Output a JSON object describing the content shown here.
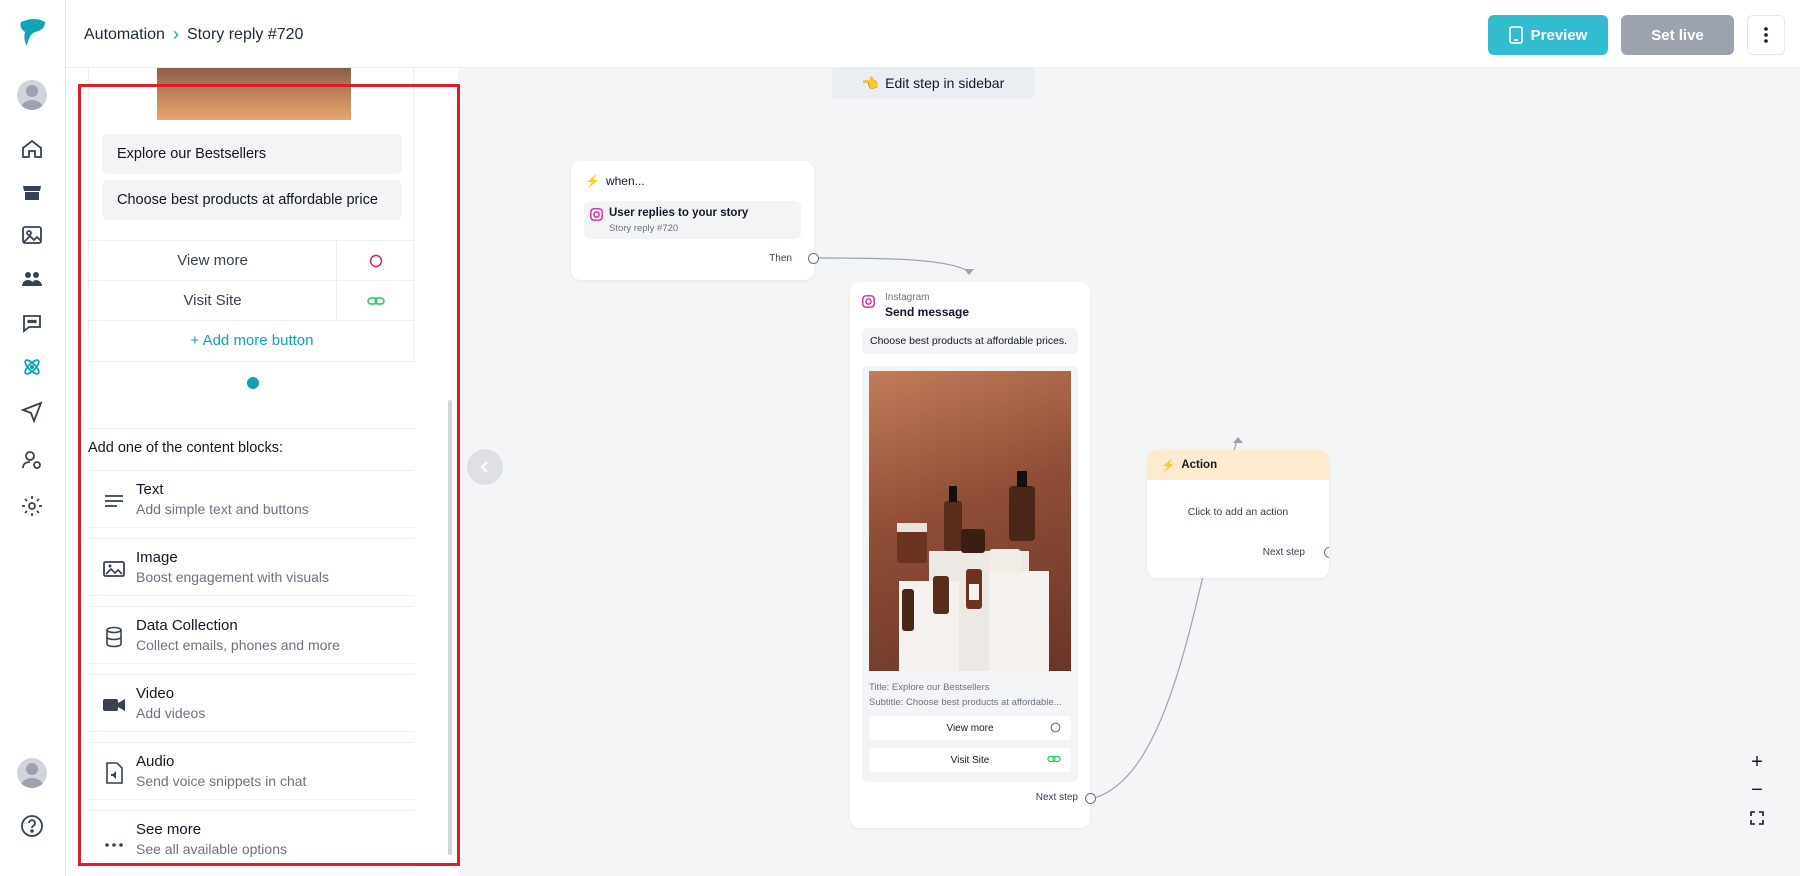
{
  "breadcrumb": {
    "root": "Automation",
    "current": "Story reply #720"
  },
  "toolbar": {
    "preview_label": "Preview",
    "set_live_label": "Set live"
  },
  "sidebar_card": {
    "title_value": "Explore our Bestsellers",
    "subtitle_value": "Choose best products at affordable price",
    "buttons": [
      {
        "label": "View more"
      },
      {
        "label": "Visit Site"
      }
    ],
    "add_more_label": "+ Add more button"
  },
  "content_blocks": {
    "heading": "Add one of the content blocks:",
    "items": [
      {
        "title": "Text",
        "desc": "Add simple text and buttons",
        "icon": "lines-icon"
      },
      {
        "title": "Image",
        "desc": "Boost engagement with visuals",
        "icon": "image-icon"
      },
      {
        "title": "Data Collection",
        "desc": "Collect emails, phones and more",
        "icon": "database-icon"
      },
      {
        "title": "Video",
        "desc": "Add videos",
        "icon": "video-camera-icon"
      },
      {
        "title": "Audio",
        "desc": "Send voice snippets in chat",
        "icon": "audio-file-icon"
      },
      {
        "title": "See more",
        "desc": "See all available options",
        "icon": "ellipsis-icon"
      }
    ]
  },
  "canvas": {
    "hint": "Edit step in sidebar",
    "when_node": {
      "header": "when...",
      "trigger_title": "User replies to your story",
      "trigger_sub": "Story reply #720",
      "then_label": "Then"
    },
    "send_node": {
      "platform": "Instagram",
      "title": "Send message",
      "text": "Choose best products at affordable prices.",
      "caption_title": "Title: Explore our Bestsellers",
      "caption_subtitle": "Subtitle: Choose best products at affordable...",
      "buttons": [
        {
          "label": "View more"
        },
        {
          "label": "Visit Site"
        }
      ],
      "next_label": "Next step"
    },
    "action_node": {
      "header": "Action",
      "body": "Click to add an action",
      "next_label": "Next step"
    }
  },
  "colors": {
    "accent": "#31bcd0",
    "highlight": "#e11d2a",
    "disabled": "#9ca3af",
    "action_header": "#fdebd0"
  }
}
